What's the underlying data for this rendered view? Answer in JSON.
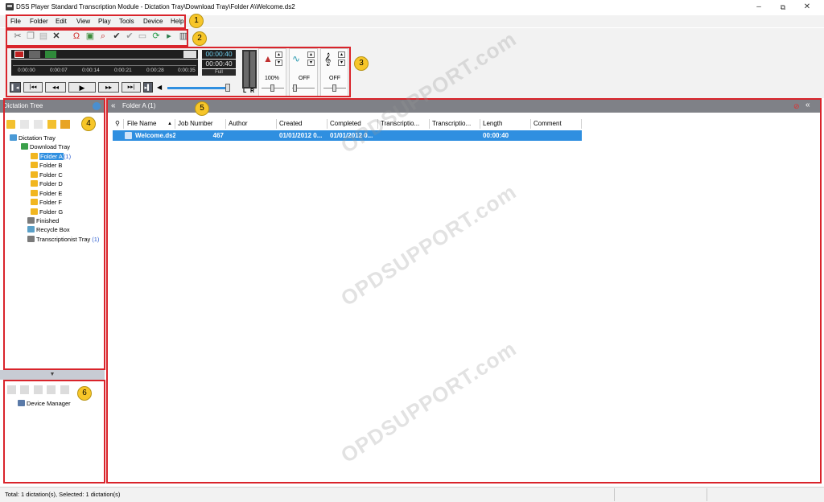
{
  "window": {
    "title": "DSS Player Standard Transcription Module - Dictation Tray\\Download Tray\\Folder A\\Welcome.ds2",
    "minimize": "–",
    "restore": "⧉",
    "close": "✕"
  },
  "menu": [
    "File",
    "Folder",
    "Edit",
    "View",
    "Play",
    "Tools",
    "Device",
    "Help"
  ],
  "toolbar_icons": [
    "cut-icon",
    "copy-icon",
    "paste-icon",
    "delete-icon",
    "headphones-icon",
    "document-icon",
    "search-icon",
    "check-icon",
    "check-gray-icon",
    "card-icon",
    "refresh-icon",
    "forward-icon",
    "settings-icon"
  ],
  "player": {
    "time_elapsed": "00:00:40",
    "time_total": "00:00:40",
    "ticks": [
      "0:00:00",
      "0:00:07",
      "0:00:14",
      "0:00:21",
      "0:00:28",
      "0:00:35"
    ],
    "full_label": "Full",
    "speed_value": "100%",
    "noise_value": "OFF",
    "tone_value": "OFF",
    "lr_labels": [
      "L",
      "R"
    ]
  },
  "callouts": [
    "1",
    "2",
    "3",
    "4",
    "5",
    "6"
  ],
  "dictation_tree": {
    "header": "Dictation Tree",
    "items": [
      {
        "label": "Dictation Tray",
        "level": 0
      },
      {
        "label": "Download Tray",
        "level": 1
      },
      {
        "label": "Folder A",
        "count": "(1)",
        "level": 2,
        "selected": true
      },
      {
        "label": "Folder B",
        "level": 2
      },
      {
        "label": "Folder C",
        "level": 2
      },
      {
        "label": "Folder D",
        "level": 2
      },
      {
        "label": "Folder E",
        "level": 2
      },
      {
        "label": "Folder F",
        "level": 2
      },
      {
        "label": "Folder G",
        "level": 2
      },
      {
        "label": "Finished",
        "level": 1
      },
      {
        "label": "Recycle Box",
        "level": 1
      },
      {
        "label": "Transcriptionist Tray",
        "count": "(1)",
        "level": 1
      }
    ]
  },
  "device_tree": {
    "collapse_icon": "▼",
    "items": [
      {
        "label": "Device Manager"
      }
    ]
  },
  "list_panel": {
    "header": "Folder A (1)",
    "columns": [
      "File Name",
      "Job Number",
      "Author",
      "Created",
      "Completed",
      "Transcriptio...",
      "Transcriptio...",
      "Length",
      "Comment"
    ],
    "rows": [
      {
        "file_name": "Welcome.ds2",
        "job_number": "467",
        "author": "",
        "created": "01/01/2012 0...",
        "completed": "01/01/2012 0...",
        "trans1": "",
        "trans2": "",
        "length": "00:00:40",
        "comment": ""
      }
    ]
  },
  "watermark": "OPDSUPPORT.com",
  "status": {
    "text": "Total: 1 dictation(s), Selected: 1 dictation(s)"
  },
  "colors": {
    "accent_red": "#d9242b",
    "callout_yellow": "#f7c629",
    "selection_blue": "#2f8fe0",
    "header_gray": "#7f8187"
  }
}
